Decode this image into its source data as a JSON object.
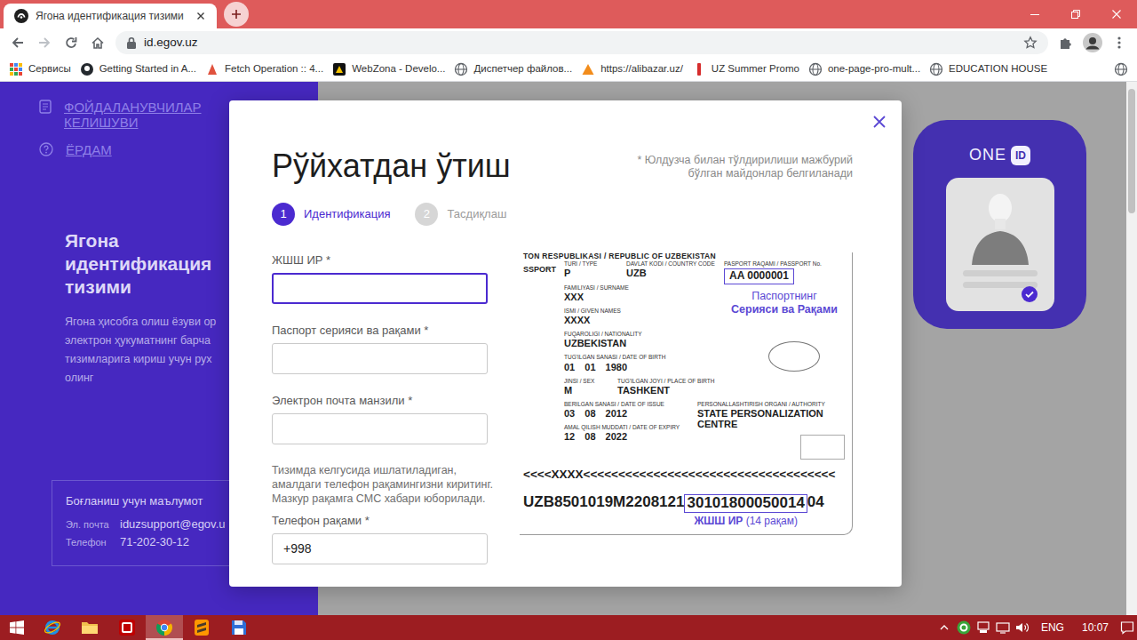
{
  "browser": {
    "tabs": [
      {
        "label": "Ягона идентификация тизими",
        "selected": true
      }
    ],
    "address": "id.egov.uz",
    "bookmarks": [
      {
        "label": "Сервисы",
        "kind": "apps"
      },
      {
        "label": "Getting Started in A...",
        "kind": "dark"
      },
      {
        "label": "Fetch Operation :: 4...",
        "kind": "fetch"
      },
      {
        "label": "WebZona - Develo...",
        "kind": "webzona"
      },
      {
        "label": "Диспетчер файлов...",
        "kind": "globe"
      },
      {
        "label": "https://alibazar.uz/",
        "kind": "alibazar"
      },
      {
        "label": "UZ Summer Promo",
        "kind": "promo"
      },
      {
        "label": "one-page-pro-mult...",
        "kind": "globe"
      },
      {
        "label": "EDUCATION HOUSE",
        "kind": "globe"
      }
    ]
  },
  "sidebar": {
    "menu": [
      {
        "label": "ФОЙДАЛАНУВЧИЛАР КЕЛИШУВИ",
        "kind": "document"
      },
      {
        "label": "ЁРДАМ",
        "kind": "help"
      }
    ],
    "title": "Ягона идентификация тизими",
    "description": [
      "Ягона ҳисобга олиш ёзуви ор",
      "электрон ҳукуматнинг барча",
      "тизимларига кириш учун рух",
      "олинг"
    ],
    "contact": {
      "title": "Боғланиш учун маълумот",
      "rows": [
        {
          "label": "Эл. почта",
          "value": "iduzsupport@egov.u"
        },
        {
          "label": "Телефон",
          "value": "71-202-30-12"
        }
      ]
    }
  },
  "brand": {
    "one": "ONE",
    "id": "ID"
  },
  "modal": {
    "title": "Рўйхатдан ўтиш",
    "note": "* Юлдузча билан тўлдирилиши мажбурий бўлган майдонлар белгиланади",
    "steps": [
      {
        "number": "1",
        "label": "Идентификация",
        "selected": true
      },
      {
        "number": "2",
        "label": "Тасдиқлаш",
        "selected": false
      }
    ],
    "fields": [
      {
        "label": "ЖШШ ИР *",
        "value": "",
        "focused": true
      },
      {
        "label": "Паспорт серияси ва рақами *",
        "value": "",
        "focused": false
      },
      {
        "label": "Электрон почта манзили *",
        "value": "",
        "focused": false
      }
    ],
    "phone_hint": "Тизимда келгусида ишлатиладиган, амалдаги телефон рақамингизни киритинг. Мазкур рақамга СМС хабари юборилади.",
    "phone": {
      "label": "Телефон рақами *",
      "value": "+998",
      "focused": false
    },
    "passport": {
      "header": "TON RESPUBLIKASI / REPUBLIC OF UZBEKISTAN",
      "doc_word": "SSPORT",
      "top_fields": [
        {
          "label": "TURI / TYPE",
          "value": "P"
        },
        {
          "label": "DAVLAT KODI / COUNTRY CODE",
          "value": "UZB"
        }
      ],
      "number": {
        "label": "PASPORT RAQAMI / PASSPORT No.",
        "value": "AA 0000001"
      },
      "number_caption": [
        "Паспортнинг",
        "Серияси ва Рақами"
      ],
      "fields": [
        {
          "label": "FAMILIYASI / SURNAME",
          "value": "XXX"
        },
        {
          "label": "ISMI / GIVEN NAMES",
          "value": "XXXX"
        },
        {
          "label": "FUQAROLIGI / NATIONALITY",
          "value": "UZBEKISTAN"
        },
        {
          "label": "TUG'ILGAN SANASI / DATE OF BIRTH",
          "value": "01 01 1980"
        }
      ],
      "birth_row": [
        {
          "label": "JINSI / SEX",
          "value": "M"
        },
        {
          "label": "TUG'ILGAN JOYI / PLACE OF BIRTH",
          "value": "TASHKENT"
        }
      ],
      "issue_fields": [
        {
          "label": "BERILGAN SANASI / DATE OF ISSUE",
          "value": "03 08 2012"
        },
        {
          "label": "AMAL QILISH MUDDATI / DATE OF EXPIRY",
          "value": "12 08 2022"
        }
      ],
      "authority": {
        "label": "PERSONALLASHTIRISH ORGANI / AUTHORITY",
        "value": "STATE PERSONALIZATION CENTRE"
      },
      "mrz1": "<<<<XXXX<<<<<<<<<<<<<<<<<<<<<<<<<<<<<<<<<<<<",
      "mrz2": {
        "before": "UZB8501019M2208121",
        "pin": "30101800050014",
        "after": "04"
      },
      "pin_caption": {
        "label": "ЖШШ ИР",
        "note": "(14 рақам)"
      }
    }
  },
  "taskbar": {
    "apps": [
      {
        "kind": "ie",
        "selected": false
      },
      {
        "kind": "folder",
        "selected": false
      },
      {
        "kind": "filezilla",
        "selected": false
      },
      {
        "kind": "chrome",
        "selected": true
      },
      {
        "kind": "sublime",
        "selected": false
      },
      {
        "kind": "save",
        "selected": false
      }
    ],
    "language": "ENG",
    "time": "10:07"
  }
}
